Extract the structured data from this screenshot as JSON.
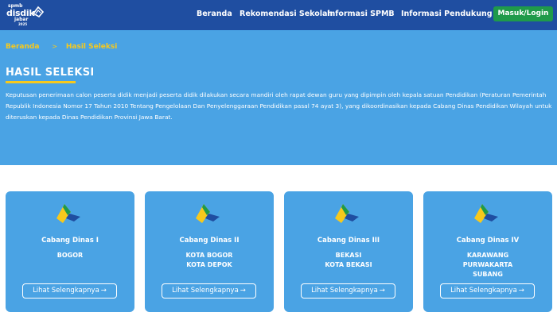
{
  "logo": {
    "line1": "spmb",
    "line2": "disdik",
    "line3": "jabar",
    "line4": "2025"
  },
  "nav": {
    "items": [
      {
        "label": "Beranda"
      },
      {
        "label": "Rekomendasi Sekolah"
      },
      {
        "label": "Informasi SPMB"
      },
      {
        "label": "Informasi Pendukung"
      }
    ],
    "login_label": "Masuk/Login"
  },
  "breadcrumb": {
    "home": "Beranda",
    "separator": ">",
    "current": "Hasil Seleksi"
  },
  "hero": {
    "title": "HASIL SELEKSI",
    "description": "Keputusan penerimaan calon peserta didik menjadi peserta didik dilakukan secara mandiri oleh rapat dewan guru yang dipimpin oleh kepala satuan Pendidikan (Peraturan Pemerintah Republik Indonesia Nomor 17 Tahun 2010 Tentang Pengelolaan Dan Penyelenggaraan Pendidikan pasal 74 ayat 3), yang dikoordinasikan kepada Cabang Dinas Pendidikan Wilayah untuk diteruskan kepada Dinas Pendidikan Provinsi Jawa Barat."
  },
  "cards": [
    {
      "title": "Cabang Dinas I",
      "cities": [
        "BOGOR"
      ],
      "button": "Lihat Selengkapnya",
      "arrow": "→"
    },
    {
      "title": "Cabang Dinas II",
      "cities": [
        "KOTA BOGOR",
        "KOTA DEPOK"
      ],
      "button": "Lihat Selengkapnya",
      "arrow": "→"
    },
    {
      "title": "Cabang Dinas III",
      "cities": [
        "BEKASI",
        "KOTA BEKASI"
      ],
      "button": "Lihat Selengkapnya",
      "arrow": "→"
    },
    {
      "title": "Cabang Dinas IV",
      "cities": [
        "KARAWANG",
        "PURWAKARTA",
        "SUBANG"
      ],
      "button": "Lihat Selengkapnya",
      "arrow": "→"
    }
  ],
  "colors": {
    "navbar": "#1f4ea1",
    "hero": "#4aa3e4",
    "accent_yellow": "#f7c91c",
    "login_green": "#1f9a4a"
  },
  "icons": {
    "nav_dropdown": "chevron-down-icon",
    "card_logo": "disdik-logo-icon",
    "button_arrow": "arrow-right-icon"
  }
}
